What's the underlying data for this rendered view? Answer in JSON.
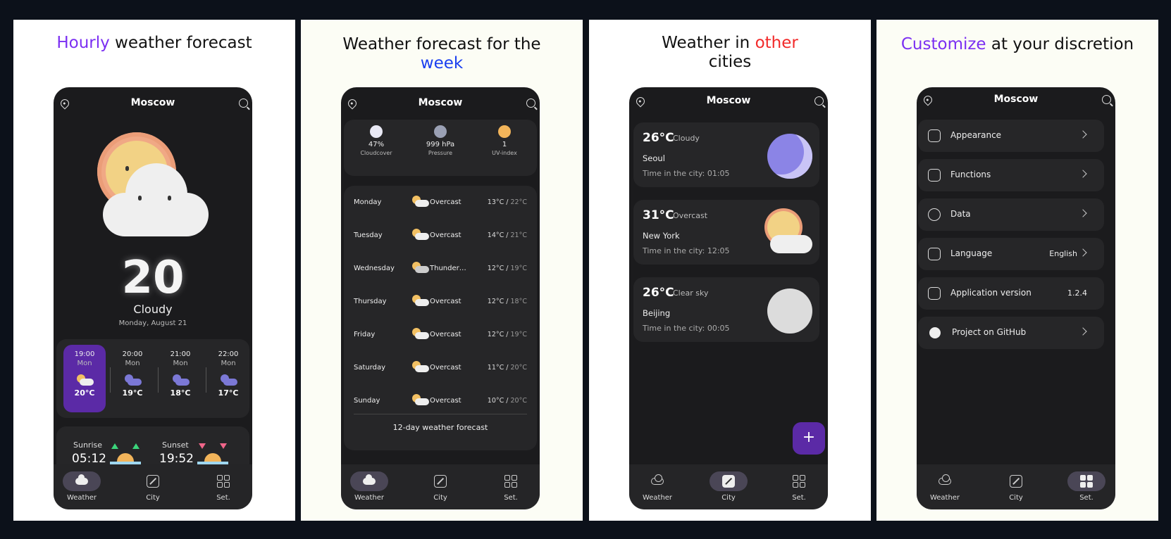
{
  "panels": [
    {
      "headline_accent": "Hourly",
      "headline_rest": " weather forecast"
    },
    {
      "headline_pre": "Weather forecast for the ",
      "headline_accent": "week"
    },
    {
      "headline_pre": "Weather in ",
      "headline_accent": "other",
      "headline_post": " cities"
    },
    {
      "headline_accent": "Customize",
      "headline_rest": " at your discretion"
    }
  ],
  "city": "Moscow",
  "nav": {
    "weather": "Weather",
    "city": "City",
    "settings": "Set."
  },
  "weather": {
    "temp": "20",
    "condition": "Cloudy",
    "date": "Monday, August 21",
    "hourly": [
      {
        "time": "19:00",
        "day": "Mon",
        "temp": "20°C",
        "icon": "sun-cloud",
        "active": true
      },
      {
        "time": "20:00",
        "day": "Mon",
        "temp": "19°C",
        "icon": "moon-cloud"
      },
      {
        "time": "21:00",
        "day": "Mon",
        "temp": "18°C",
        "icon": "moon-cloud"
      },
      {
        "time": "22:00",
        "day": "Mon",
        "temp": "17°C",
        "icon": "moon-cloud"
      }
    ],
    "sunrise_label": "Sunrise",
    "sunrise": "05:12",
    "sunset_label": "Sunset",
    "sunset": "19:52"
  },
  "weekly": {
    "stats": [
      {
        "value": "47%",
        "label": "Cloudcover",
        "icon": "cloud-icon"
      },
      {
        "value": "999 hPa",
        "label": "Pressure",
        "icon": "pressure-icon"
      },
      {
        "value": "1",
        "label": "UV-index",
        "icon": "uv-sun-icon"
      }
    ],
    "days": [
      {
        "day": "Monday",
        "cond": "Overcast",
        "low": "13°C",
        "high": "22°C"
      },
      {
        "day": "Tuesday",
        "cond": "Overcast",
        "low": "14°C",
        "high": "21°C"
      },
      {
        "day": "Wednesday",
        "cond": "Thunder…",
        "low": "12°C",
        "high": "19°C"
      },
      {
        "day": "Thursday",
        "cond": "Overcast",
        "low": "12°C",
        "high": "18°C"
      },
      {
        "day": "Friday",
        "cond": "Overcast",
        "low": "12°C",
        "high": "19°C"
      },
      {
        "day": "Saturday",
        "cond": "Overcast",
        "low": "11°C",
        "high": "20°C"
      },
      {
        "day": "Sunday",
        "cond": "Overcast",
        "low": "10°C",
        "high": "20°C"
      }
    ],
    "more": "12-day weather forecast"
  },
  "cities": [
    {
      "temp": "26°C",
      "cond": "Cloudy",
      "name": "Seoul",
      "time": "Time in the city: 01:05",
      "art": "moon"
    },
    {
      "temp": "31°C",
      "cond": "Overcast",
      "name": "New York",
      "time": "Time in the city: 12:05",
      "art": "sun-cloud"
    },
    {
      "temp": "26°C",
      "cond": "Clear sky",
      "name": "Beijing",
      "time": "Time in the city: 00:05",
      "art": "full-moon"
    }
  ],
  "fab": "+",
  "settings": [
    {
      "label": "Appearance",
      "icon": "brush-icon"
    },
    {
      "label": "Functions",
      "icon": "terminal-icon"
    },
    {
      "label": "Data",
      "icon": "box-icon"
    },
    {
      "label": "Language",
      "value": "English",
      "icon": "language-icon"
    },
    {
      "label": "Application version",
      "value": "1.2.4",
      "icon": "version-icon"
    },
    {
      "label": "Project on GitHub",
      "icon": "github-icon"
    }
  ],
  "colors": {
    "accent": "#5b2aa6",
    "purple": "#7b2ff2",
    "blue": "#1a3ff0",
    "red": "#f22a2a"
  }
}
